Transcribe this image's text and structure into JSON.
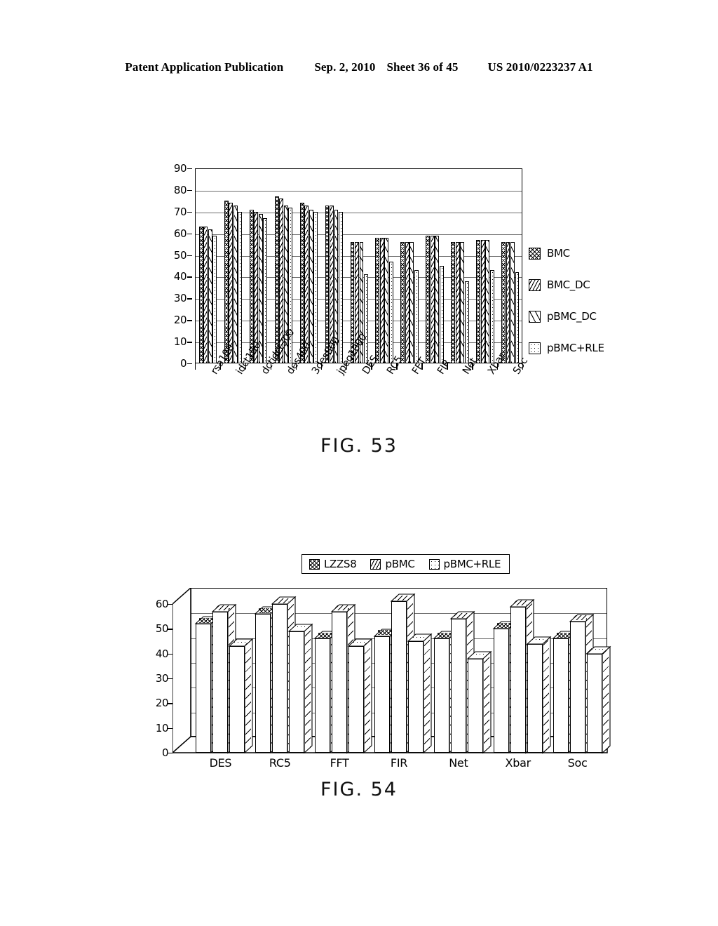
{
  "header": {
    "publication": "Patent Application Publication",
    "date": "Sep. 2, 2010",
    "sheet": "Sheet 36 of 45",
    "patent_number": "US 2010/0223237 A1"
  },
  "figures": [
    {
      "caption": "FIG. 53"
    },
    {
      "caption": "FIG. 54"
    }
  ],
  "chart_data": [
    {
      "type": "bar",
      "title": "FIG. 53",
      "xlabel": "",
      "ylabel": "",
      "ylim": [
        0,
        90
      ],
      "yticks": [
        0,
        10,
        20,
        30,
        40,
        50,
        60,
        70,
        80,
        90
      ],
      "grid": true,
      "legend_position": "right",
      "categories": [
        "rsa100",
        "idct150",
        "dctidct300",
        "des400",
        "3des800",
        "jpeg1000",
        "DES",
        "RC5",
        "FFT",
        "FIR",
        "Net",
        "Xbar",
        "Soc"
      ],
      "series": [
        {
          "name": "BMC",
          "fill": "crosshatch",
          "values": [
            63,
            75,
            71,
            77,
            74,
            73,
            56,
            58,
            56,
            59,
            56,
            57,
            56
          ]
        },
        {
          "name": "BMC_DC",
          "fill": "diagonal",
          "values": [
            63,
            74,
            70,
            76,
            73,
            73,
            56,
            58,
            56,
            59,
            56,
            57,
            56
          ]
        },
        {
          "name": "pBMC_DC",
          "fill": "thin-diagonal",
          "values": [
            62,
            73,
            69,
            73,
            71,
            71,
            56,
            58,
            56,
            59,
            56,
            57,
            56
          ]
        },
        {
          "name": "pBMC+RLE",
          "fill": "dotted",
          "values": [
            59,
            70,
            67,
            72,
            70,
            70,
            41,
            47,
            43,
            45,
            38,
            43,
            42
          ]
        }
      ]
    },
    {
      "type": "bar",
      "title": "FIG. 54",
      "xlabel": "",
      "ylabel": "",
      "ylim": [
        0,
        60
      ],
      "yticks": [
        0,
        10,
        20,
        30,
        40,
        50,
        60
      ],
      "grid": true,
      "legend_position": "top",
      "three_d": true,
      "categories": [
        "DES",
        "RC5",
        "FFT",
        "FIR",
        "Net",
        "Xbar",
        "Soc"
      ],
      "series": [
        {
          "name": "LZZS8",
          "fill": "crosshatch",
          "values": [
            52,
            56,
            46,
            47,
            46,
            50,
            46
          ]
        },
        {
          "name": "pBMC",
          "fill": "diagonal",
          "values": [
            57,
            60,
            57,
            61,
            54,
            59,
            53
          ]
        },
        {
          "name": "pBMC+RLE",
          "fill": "dotted",
          "values": [
            43,
            49,
            43,
            45,
            38,
            44,
            40
          ]
        }
      ]
    }
  ]
}
